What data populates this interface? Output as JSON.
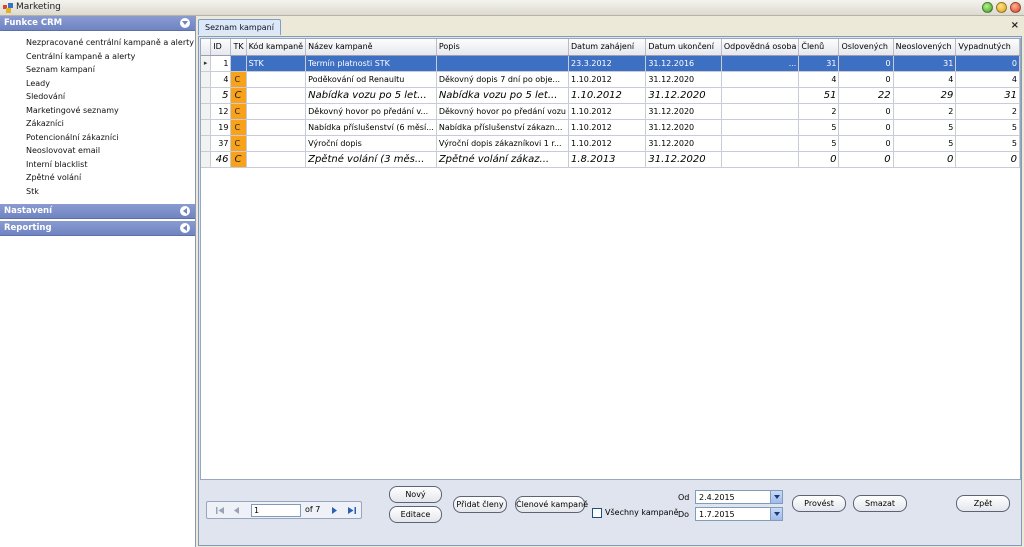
{
  "window": {
    "title": "Marketing"
  },
  "sidebar": {
    "groups": [
      {
        "title": "Funkce CRM",
        "expanded": true,
        "items": [
          "Nezpracované centrální kampaně a alerty",
          "Centrální kampaně a alerty",
          "Seznam kampaní",
          "Leady",
          "Sledování",
          "Marketingové seznamy",
          "Zákazníci",
          "Potencionální zákazníci",
          "Neoslovovat email",
          "Interní blacklist",
          "Zpětné volání",
          "Stk"
        ]
      },
      {
        "title": "Nastavení",
        "expanded": false
      },
      {
        "title": "Reporting",
        "expanded": false
      }
    ]
  },
  "main": {
    "tab": "Seznam kampaní",
    "close_glyph": "×"
  },
  "grid": {
    "columns": [
      "ID",
      "TK",
      "Kód kampaně",
      "Název kampaně",
      "Popis",
      "Datum zahájení",
      "Datum ukončení",
      "Odpovědná osoba",
      "Členů",
      "Oslovených",
      "Neoslovených",
      "Vypadnutých"
    ],
    "rows": [
      [
        "1",
        "",
        "STK",
        "Termín platnosti STK",
        "",
        "23.3.2012",
        "31.12.2016",
        "...",
        "31",
        "0",
        "31",
        "0"
      ],
      [
        "4",
        "C",
        "",
        "Poděkování od Renaultu",
        "Děkovný dopis 7 dní po obje...",
        "1.10.2012",
        "31.12.2020",
        "",
        "4",
        "0",
        "4",
        "4"
      ],
      [
        "5",
        "C",
        "",
        "Nabídka vozu po 5 let...",
        "Nabídka vozu po 5 let...",
        "1.10.2012",
        "31.12.2020",
        "",
        "51",
        "22",
        "29",
        "31"
      ],
      [
        "12",
        "C",
        "",
        "Děkovný hovor po předání v...",
        "Děkovný hovor po předání vozu",
        "1.10.2012",
        "31.12.2020",
        "",
        "2",
        "0",
        "2",
        "2"
      ],
      [
        "19",
        "C",
        "",
        "Nabídka příslušenství (6 měsí...",
        "Nabídka příslušenství zákazn...",
        "1.10.2012",
        "31.12.2020",
        "",
        "5",
        "0",
        "5",
        "5"
      ],
      [
        "37",
        "C",
        "",
        "Výroční dopis",
        "Výroční dopis zákazníkovi 1 r...",
        "1.10.2012",
        "31.12.2020",
        "",
        "5",
        "0",
        "5",
        "5"
      ],
      [
        "46",
        "C",
        "",
        "Zpětné volání (3 měs...",
        "Zpětné volání zákaz...",
        "1.8.2013",
        "31.12.2020",
        "",
        "0",
        "0",
        "0",
        "0"
      ]
    ],
    "selected_row": 0,
    "row_indicator": "▸"
  },
  "pager": {
    "current": "1",
    "of_label": "of 7"
  },
  "buttons": {
    "new": "Nový",
    "edit": "Editace",
    "add_members": "Přidat členy",
    "members": "Členové kampaně",
    "execute": "Provést",
    "delete": "Smazat",
    "back": "Zpět"
  },
  "filter": {
    "all_campaigns_label": "Všechny kampaně",
    "all_campaigns_checked": false,
    "from_label": "Od",
    "from_value": "2.4.2015",
    "to_label": "Do",
    "to_value": "1.7.2015"
  },
  "colors": {
    "selection": "#3d6fc3",
    "tk_orange": "#f7a21a",
    "sidebar_header": "#7a8ecb"
  },
  "icons": {
    "group_expand": "chevron-down-icon",
    "group_collapse": "chevron-left-icon",
    "pager_first": "first-page-icon",
    "pager_prev": "prev-page-icon",
    "pager_next": "next-page-icon",
    "pager_last": "last-page-icon"
  }
}
